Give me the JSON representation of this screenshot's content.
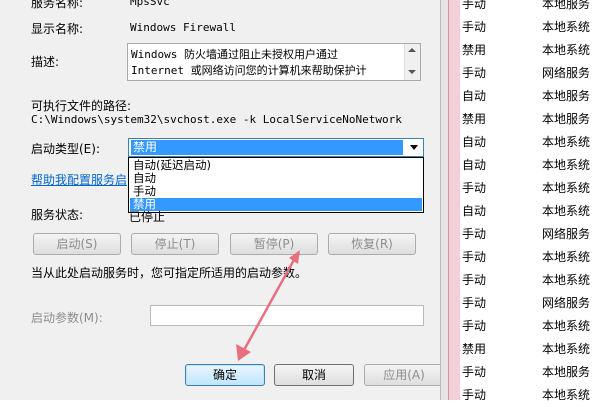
{
  "properties": {
    "service_name_label": "服务名称:",
    "service_name_value": "MpsSvc",
    "display_name_label": "显示名称:",
    "display_name_value": "Windows Firewall",
    "description_label": "描述:",
    "description_lines": [
      "Windows 防火墙通过阻止未授权用户通过",
      "Internet 或网络访问您的计算机来帮助保护计"
    ],
    "exe_path_label": "可执行文件的路径:",
    "exe_path_value": "C:\\Windows\\system32\\svchost.exe -k LocalServiceNoNetwork",
    "startup_type_label": "启动类型(E):",
    "startup_type_selected": "禁用",
    "startup_options": [
      "自动(延迟启动)",
      "自动",
      "手动",
      "禁用"
    ],
    "help_link": "帮助我配置服务启",
    "status_label": "服务状态:",
    "status_value": "已停止",
    "buttons": {
      "start": "启动(S)",
      "stop": "停止(T)",
      "pause": "暂停(P)",
      "resume": "恢复(R)"
    },
    "hint_text": "当从此处启动服务时，您可指定所适用的启动参数。",
    "start_params_label": "启动参数(M):",
    "start_params_value": "",
    "footer": {
      "ok": "确定",
      "cancel": "取消",
      "apply": "应用(A)"
    }
  },
  "services_list": [
    {
      "startup": "手动",
      "logon": "本地服务"
    },
    {
      "startup": "手动",
      "logon": "本地系统"
    },
    {
      "startup": "禁用",
      "logon": "本地系统"
    },
    {
      "startup": "手动",
      "logon": "网络服务"
    },
    {
      "startup": "自动",
      "logon": "本地服务"
    },
    {
      "startup": "禁用",
      "logon": "本地服务"
    },
    {
      "startup": "自动",
      "logon": "本地系统"
    },
    {
      "startup": "自动",
      "logon": "本地系统"
    },
    {
      "startup": "手动",
      "logon": "本地系统"
    },
    {
      "startup": "自动",
      "logon": "本地系统"
    },
    {
      "startup": "手动",
      "logon": "网络服务"
    },
    {
      "startup": "手动",
      "logon": "本地系统"
    },
    {
      "startup": "手动",
      "logon": "本地系统"
    },
    {
      "startup": "手动",
      "logon": "网络服务"
    },
    {
      "startup": "手动",
      "logon": "本地系统"
    },
    {
      "startup": "禁用",
      "logon": "本地系统"
    },
    {
      "startup": "手动",
      "logon": "本地服务"
    },
    {
      "startup": "手动",
      "logon": "本地系统"
    }
  ],
  "colors": {
    "selection": "#3399ff",
    "link": "#0066cc",
    "annotation_arrow": "#e8707e"
  }
}
